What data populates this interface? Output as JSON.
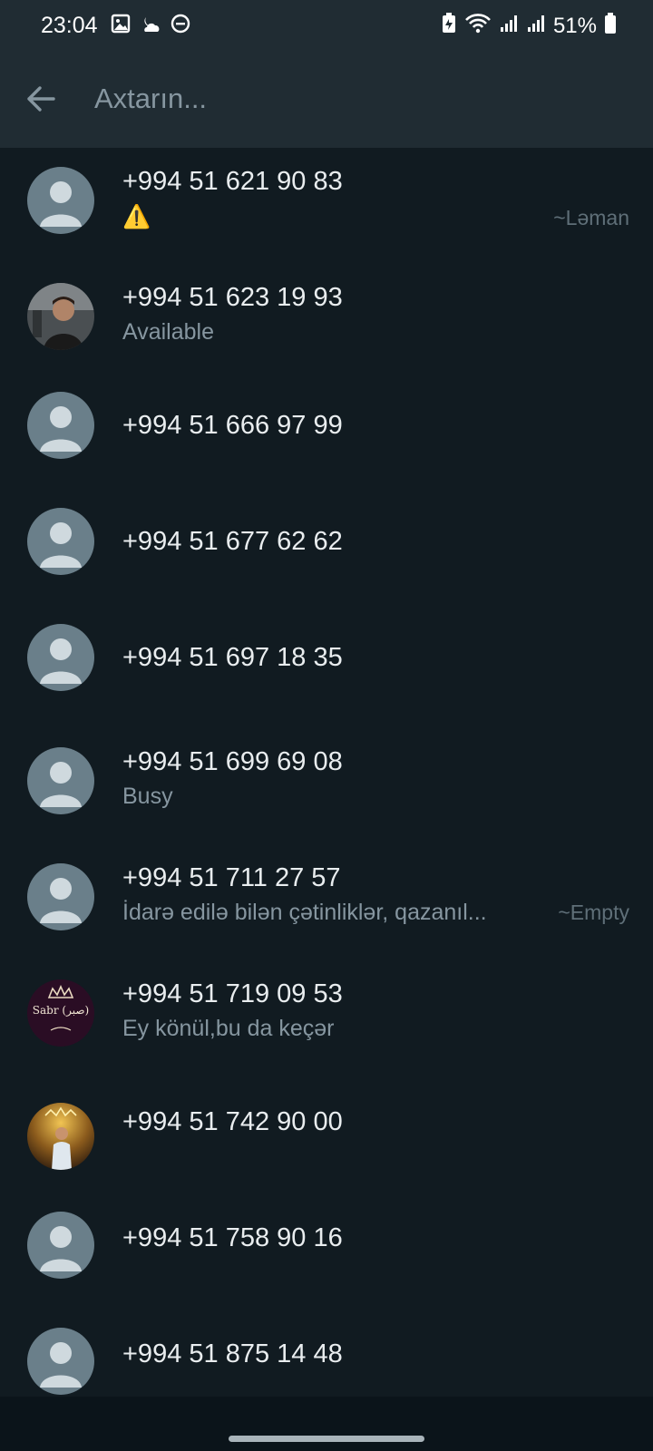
{
  "status_bar": {
    "time": "23:04",
    "battery_percent": "51%",
    "icons": [
      "image-icon",
      "weather-icon",
      "do-not-disturb-icon",
      "battery-saver-icon",
      "wifi-icon",
      "signal-icon",
      "signal-icon",
      "battery-icon"
    ]
  },
  "search": {
    "placeholder": "Axtarın..."
  },
  "colors": {
    "background": "#111b21",
    "header": "#202c33",
    "primary_text": "#e9edef",
    "secondary_text": "#8696a0"
  },
  "contacts": [
    {
      "name": "+994 51 621 90 83",
      "status": "⚠️",
      "alias": "~Ləman",
      "avatar": "default"
    },
    {
      "name": "+994 51 623 19 93",
      "status": "Available",
      "alias": "",
      "avatar": "photo-gym"
    },
    {
      "name": "+994 51 666 97 99",
      "status": "",
      "alias": "",
      "avatar": "default"
    },
    {
      "name": "+994 51 677 62 62",
      "status": "",
      "alias": "",
      "avatar": "default"
    },
    {
      "name": "+994 51 697 18 35",
      "status": "",
      "alias": "",
      "avatar": "default"
    },
    {
      "name": "+994 51 699 69 08",
      "status": "Busy",
      "alias": "",
      "avatar": "default"
    },
    {
      "name": "+994 51 711 27 57",
      "status": "İdarə edilə bilən çətinliklər, qazanıl...",
      "alias": "~Empty",
      "avatar": "default"
    },
    {
      "name": "+994 51 719 09 53",
      "status": "Ey könül,bu da keçər",
      "alias": "",
      "avatar": "sabr"
    },
    {
      "name": "+994 51 742 90 00",
      "status": "",
      "alias": "",
      "avatar": "photo-gold"
    },
    {
      "name": "+994 51 758 90 16",
      "status": "",
      "alias": "",
      "avatar": "default"
    },
    {
      "name": "+994 51 875 14 48",
      "status": "",
      "alias": "",
      "avatar": "default"
    }
  ],
  "avatar_texts": {
    "sabr": "Sabr (صبر)"
  }
}
